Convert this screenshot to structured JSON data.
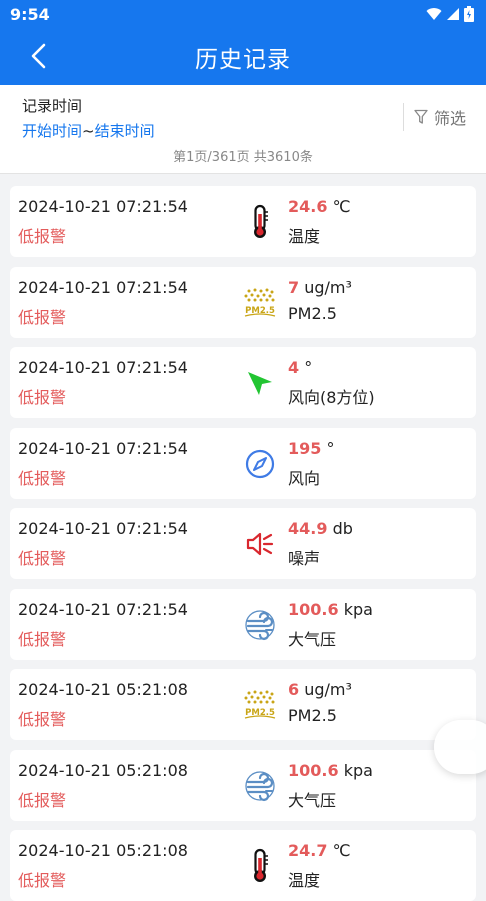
{
  "status_bar": {
    "time": "9:54"
  },
  "header": {
    "title": "历史记录"
  },
  "filter": {
    "time_label": "记录时间",
    "start_time": "开始时间",
    "separator": "~",
    "end_time": "结束时间",
    "filter_label": "筛选"
  },
  "pagination": {
    "text": "第1页/361页 共3610条"
  },
  "records": [
    {
      "timestamp": "2024-10-21 07:21:54",
      "alarm": "低报警",
      "value": "24.6",
      "unit": "℃",
      "name": "温度",
      "icon": "thermometer-icon"
    },
    {
      "timestamp": "2024-10-21 07:21:54",
      "alarm": "低报警",
      "value": "7",
      "unit": "ug/m³",
      "name": "PM2.5",
      "icon": "pm25-icon"
    },
    {
      "timestamp": "2024-10-21 07:21:54",
      "alarm": "低报警",
      "value": "4",
      "unit": "°",
      "name": "风向(8方位)",
      "icon": "direction-arrow-icon"
    },
    {
      "timestamp": "2024-10-21 07:21:54",
      "alarm": "低报警",
      "value": "195",
      "unit": "°",
      "name": "风向",
      "icon": "compass-icon"
    },
    {
      "timestamp": "2024-10-21 07:21:54",
      "alarm": "低报警",
      "value": "44.9",
      "unit": "db",
      "name": "噪声",
      "icon": "speaker-icon"
    },
    {
      "timestamp": "2024-10-21 07:21:54",
      "alarm": "低报警",
      "value": "100.6",
      "unit": "kpa",
      "name": "大气压",
      "icon": "pressure-icon"
    },
    {
      "timestamp": "2024-10-21 05:21:08",
      "alarm": "低报警",
      "value": "6",
      "unit": "ug/m³",
      "name": "PM2.5",
      "icon": "pm25-icon"
    },
    {
      "timestamp": "2024-10-21 05:21:08",
      "alarm": "低报警",
      "value": "100.6",
      "unit": "kpa",
      "name": "大气压",
      "icon": "pressure-icon"
    },
    {
      "timestamp": "2024-10-21 05:21:08",
      "alarm": "低报警",
      "value": "24.7",
      "unit": "℃",
      "name": "温度",
      "icon": "thermometer-icon"
    }
  ],
  "colors": {
    "primary": "#1677ee",
    "alarm": "#e35b5b"
  }
}
